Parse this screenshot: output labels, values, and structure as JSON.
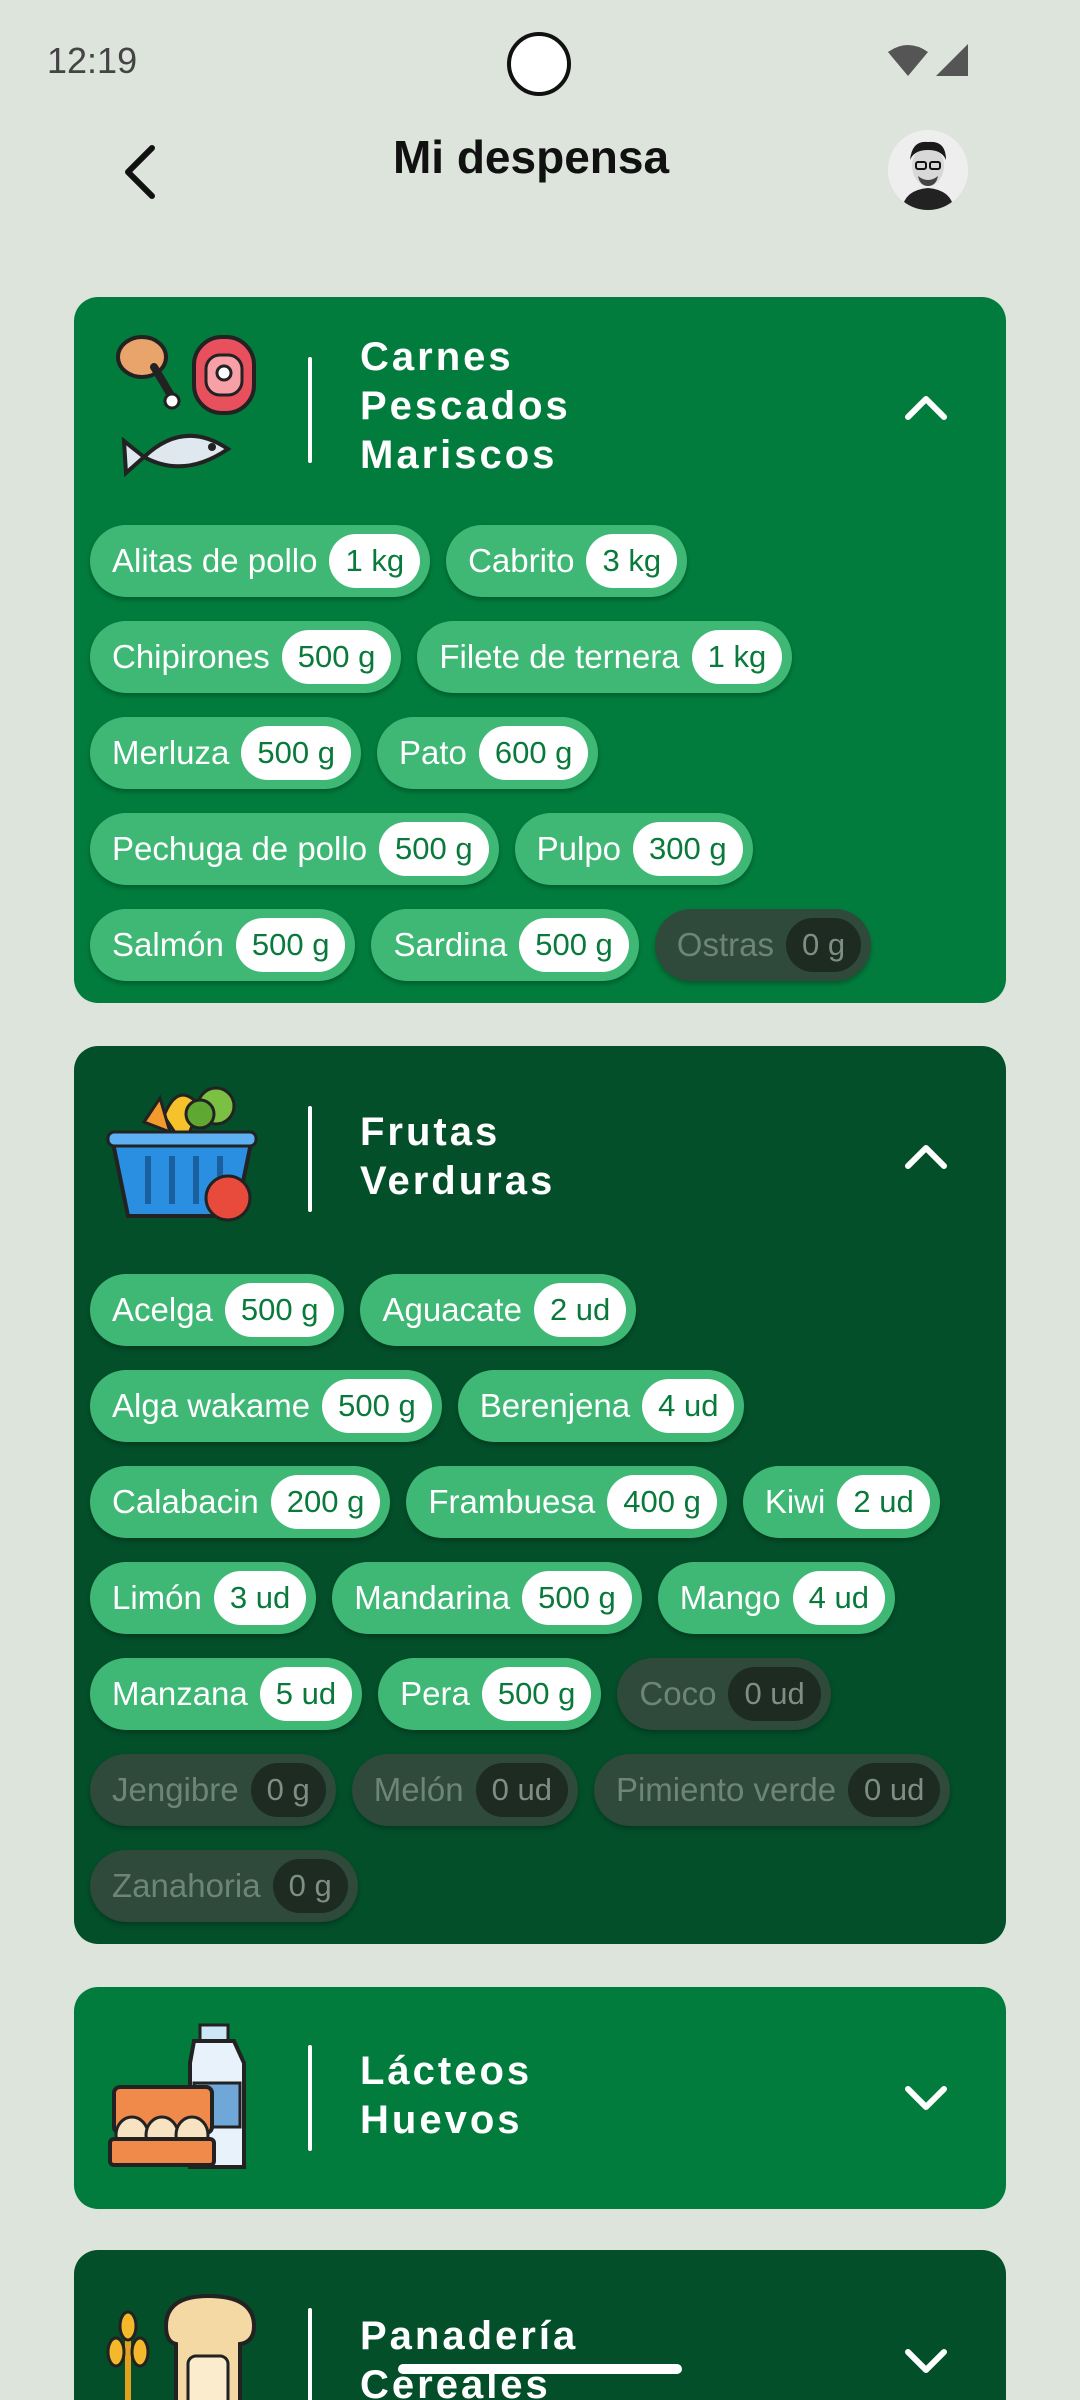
{
  "status": {
    "time": "12:19"
  },
  "header": {
    "title": "Mi despensa"
  },
  "categories": [
    {
      "title_lines": [
        "Carnes",
        "Pescados",
        "Mariscos"
      ],
      "icon": "meat-fish-icon",
      "expanded": true,
      "items": [
        {
          "name": "Alitas de pollo",
          "qty": "1 kg",
          "available": true
        },
        {
          "name": "Cabrito",
          "qty": "3 kg",
          "available": true
        },
        {
          "name": "Chipirones",
          "qty": "500 g",
          "available": true
        },
        {
          "name": "Filete de ternera",
          "qty": "1 kg",
          "available": true
        },
        {
          "name": "Merluza",
          "qty": "500 g",
          "available": true
        },
        {
          "name": "Pato",
          "qty": "600 g",
          "available": true
        },
        {
          "name": "Pechuga de pollo",
          "qty": "500 g",
          "available": true
        },
        {
          "name": "Pulpo",
          "qty": "300 g",
          "available": true
        },
        {
          "name": "Salmón",
          "qty": "500 g",
          "available": true
        },
        {
          "name": "Sardina",
          "qty": "500 g",
          "available": true
        },
        {
          "name": "Ostras",
          "qty": "0 g",
          "available": false
        }
      ]
    },
    {
      "title_lines": [
        "Frutas",
        "Verduras"
      ],
      "icon": "vegetable-basket-icon",
      "expanded": true,
      "items": [
        {
          "name": "Acelga",
          "qty": "500 g",
          "available": true
        },
        {
          "name": "Aguacate",
          "qty": "2 ud",
          "available": true
        },
        {
          "name": "Alga wakame",
          "qty": "500 g",
          "available": true
        },
        {
          "name": "Berenjena",
          "qty": "4 ud",
          "available": true
        },
        {
          "name": "Calabacin",
          "qty": "200 g",
          "available": true
        },
        {
          "name": "Frambuesa",
          "qty": "400 g",
          "available": true
        },
        {
          "name": "Kiwi",
          "qty": "2 ud",
          "available": true
        },
        {
          "name": "Limón",
          "qty": "3 ud",
          "available": true
        },
        {
          "name": "Mandarina",
          "qty": "500 g",
          "available": true
        },
        {
          "name": "Mango",
          "qty": "4 ud",
          "available": true
        },
        {
          "name": "Manzana",
          "qty": "5 ud",
          "available": true
        },
        {
          "name": "Pera",
          "qty": "500 g",
          "available": true
        },
        {
          "name": "Coco",
          "qty": "0 ud",
          "available": false
        },
        {
          "name": "Jengibre",
          "qty": "0 g",
          "available": false
        },
        {
          "name": "Melón",
          "qty": "0 ud",
          "available": false
        },
        {
          "name": "Pimiento verde",
          "qty": "0 ud",
          "available": false
        },
        {
          "name": "Zanahoria",
          "qty": "0 g",
          "available": false
        }
      ]
    },
    {
      "title_lines": [
        "Lácteos",
        "Huevos"
      ],
      "icon": "dairy-eggs-icon",
      "expanded": false,
      "items": []
    },
    {
      "title_lines": [
        "Panadería",
        "Cereales"
      ],
      "icon": "bread-cereal-icon",
      "expanded": false,
      "items": []
    }
  ],
  "colors": {
    "background": "#dde4dc",
    "card_light": "#027c3c",
    "card_dark": "#034f2a",
    "chip_on": "#3fb876",
    "chip_off": "#2f4a3a"
  }
}
